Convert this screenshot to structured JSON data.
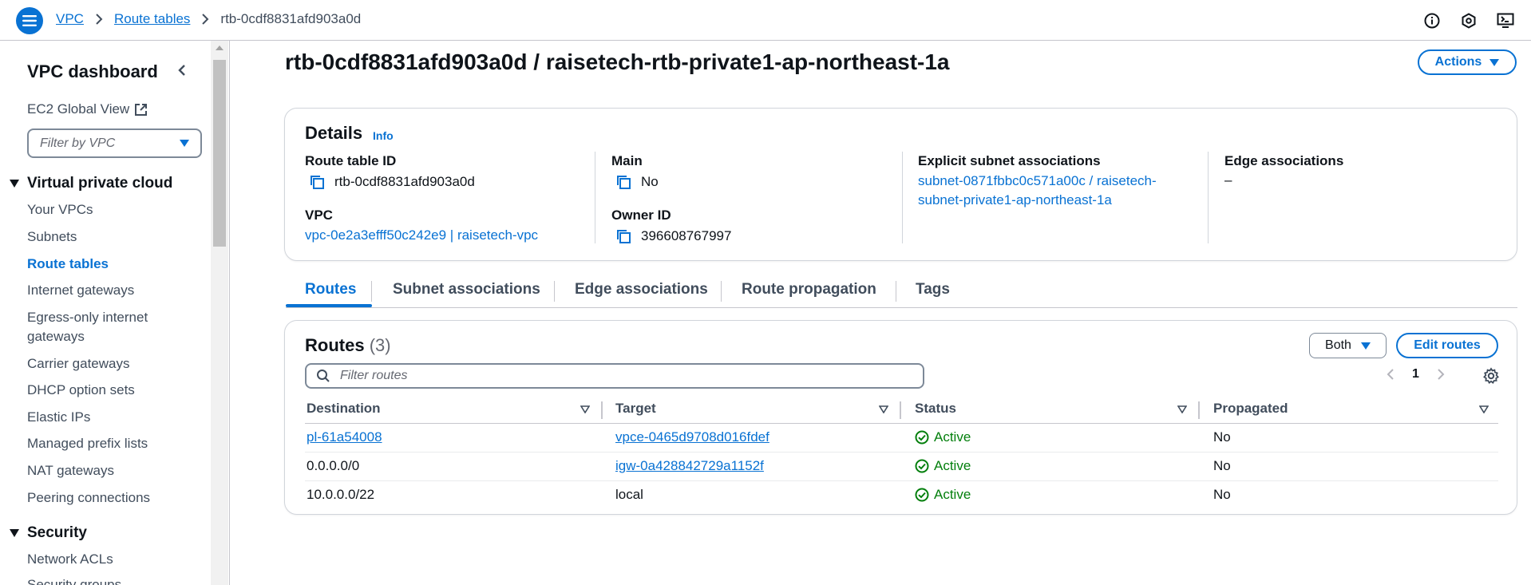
{
  "breadcrumb": {
    "items": [
      "VPC",
      "Route tables"
    ],
    "current": "rtb-0cdf8831afd903a0d"
  },
  "top_icons": [
    "info-icon",
    "cloudshell-icon",
    "notifications-icon"
  ],
  "sidebar": {
    "title": "VPC dashboard",
    "ec2_global_view": "EC2 Global View",
    "filter_placeholder": "Filter by VPC",
    "section_vpc": "Virtual private cloud",
    "items": [
      {
        "label": "Your VPCs"
      },
      {
        "label": "Subnets"
      },
      {
        "label": "Route tables"
      },
      {
        "label": "Internet gateways"
      },
      {
        "label": "Egress-only internet"
      },
      {
        "label": "gateways"
      },
      {
        "label": "Carrier gateways"
      },
      {
        "label": "DHCP option sets"
      },
      {
        "label": "Elastic IPs"
      },
      {
        "label": "Managed prefix lists"
      },
      {
        "label": "NAT gateways"
      },
      {
        "label": "Peering connections"
      }
    ],
    "section_security": "Security",
    "security_items": [
      {
        "label": "Network ACLs"
      },
      {
        "label": "Security groups"
      }
    ]
  },
  "page": {
    "title": "rtb-0cdf8831afd903a0d / raisetech-rtb-private1-ap-northeast-1a",
    "actions_label": "Actions"
  },
  "details": {
    "heading": "Details",
    "info": "Info",
    "route_table_id_label": "Route table ID",
    "route_table_id": "rtb-0cdf8831afd903a0d",
    "vpc_label": "VPC",
    "vpc_value": "vpc-0e2a3efff50c242e9 | raisetech-vpc",
    "main_label": "Main",
    "main_value": "No",
    "owner_label": "Owner ID",
    "owner_value": "396608767997",
    "explicit_label": "Explicit subnet associations",
    "explicit_line1": "subnet-0871fbbc0c571a00c / raisetech-",
    "explicit_line2": "subnet-private1-ap-northeast-1a",
    "edge_label": "Edge associations",
    "edge_value": "–"
  },
  "tabs": [
    "Routes",
    "Subnet associations",
    "Edge associations",
    "Route propagation",
    "Tags"
  ],
  "routes": {
    "heading": "Routes",
    "count": "(3)",
    "filter_value": "Both",
    "edit_label": "Edit routes",
    "search_placeholder": "Filter routes",
    "page": "1",
    "columns": [
      "Destination",
      "Target",
      "Status",
      "Propagated"
    ],
    "rows": [
      {
        "destination": "pl-61a54008",
        "target": "vpce-0465d9708d016fdef",
        "status": "Active",
        "propagated": "No"
      },
      {
        "destination": "0.0.0.0/0",
        "target": "igw-0a428842729a1152f",
        "status": "Active",
        "propagated": "No"
      },
      {
        "destination": "10.0.0.0/22",
        "target": "local",
        "status": "Active",
        "propagated": "No"
      }
    ]
  },
  "colors": {
    "accent": "#0972d3",
    "success": "#037f0c",
    "text": "#0f141a",
    "muted": "#414d5c"
  }
}
